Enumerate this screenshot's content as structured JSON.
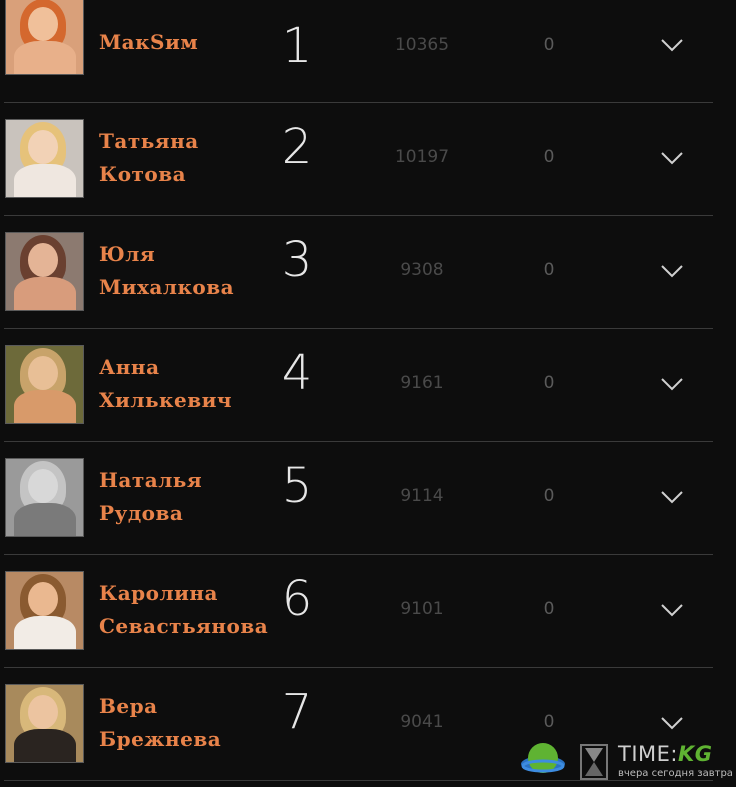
{
  "rows": [
    {
      "name_line1": "МакSим",
      "name_line2": "",
      "rank": "1",
      "votes": "10365",
      "extra": "0"
    },
    {
      "name_line1": "Татьяна",
      "name_line2": "Котова",
      "rank": "2",
      "votes": "10197",
      "extra": "0"
    },
    {
      "name_line1": "Юля",
      "name_line2": "Михалкова",
      "rank": "3",
      "votes": "9308",
      "extra": "0"
    },
    {
      "name_line1": "Анна",
      "name_line2": "Хилькевич",
      "rank": "4",
      "votes": "9161",
      "extra": "0"
    },
    {
      "name_line1": "Наталья",
      "name_line2": "Рудова",
      "rank": "5",
      "votes": "9114",
      "extra": "0"
    },
    {
      "name_line1": "Каролина",
      "name_line2": "Севастьянова",
      "rank": "6",
      "votes": "9101",
      "extra": "0"
    },
    {
      "name_line1": "Вера",
      "name_line2": "Брежнева",
      "rank": "7",
      "votes": "9041",
      "extra": "0"
    }
  ],
  "icons": {
    "expand": "chevron-down-icon",
    "logo_globe": "globe-icon",
    "logo_hourglass": "hourglass-icon"
  },
  "colors": {
    "background": "#0d0d0d",
    "name": "#e8834a",
    "rank": "#e6e6e6",
    "votes": "#4a4a4a",
    "divider": "#3a3a3a",
    "logo_accent": "#5fb332"
  },
  "watermark": {
    "brand_prefix": "TIME:",
    "brand_suffix": "KG",
    "tagline": "вчера сегодня завтра"
  }
}
